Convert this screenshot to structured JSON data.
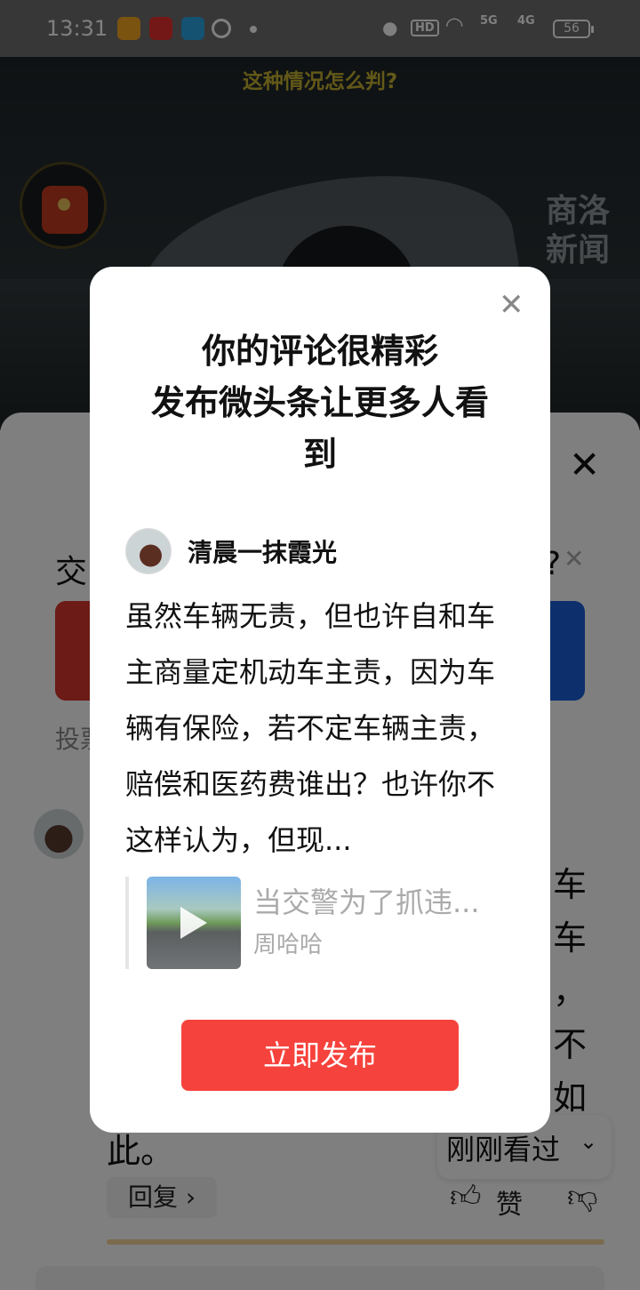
{
  "status_bar": {
    "time": "13:31",
    "apps": [
      "bilibili-style-app",
      "头条",
      "telegram",
      "wechat"
    ],
    "hd": "HD",
    "net5g": "5G",
    "net4g": "4G",
    "battery": "56"
  },
  "video": {
    "subtitle": "这种情况怎么判?",
    "watermark": "商洛新闻"
  },
  "sheet": {
    "close_icon": "close-icon",
    "poll_title": "交",
    "poll_q": "?",
    "vote_label": "投票",
    "comment_lines": [
      "车",
      "车",
      "，",
      "不",
      "如"
    ],
    "comment_end": "此。",
    "reply": "回复 ›",
    "recent": "刚刚看过",
    "like": "赞"
  },
  "modal": {
    "title": "你的评论很精彩\n发布微头条让更多人看到",
    "title_line1": "你的评论很精彩",
    "title_line2": "发布微头条让更多人看",
    "title_line3": "到",
    "username": "清晨一抹霞光",
    "comment": "虽然车辆无责，但也许自和车主商量定机动车主责，因为车辆有保险，若不定车辆主责，赔偿和医药费谁出？也许你不这样认为，但现...",
    "quote_title": "当交警为了抓违...",
    "quote_author": "周哈哈",
    "publish": "立即发布"
  },
  "colors": {
    "publish": "#f6423c",
    "vote_left": "#d8362d",
    "vote_right": "#1a5fd8",
    "subtitle": "#c5b030"
  }
}
